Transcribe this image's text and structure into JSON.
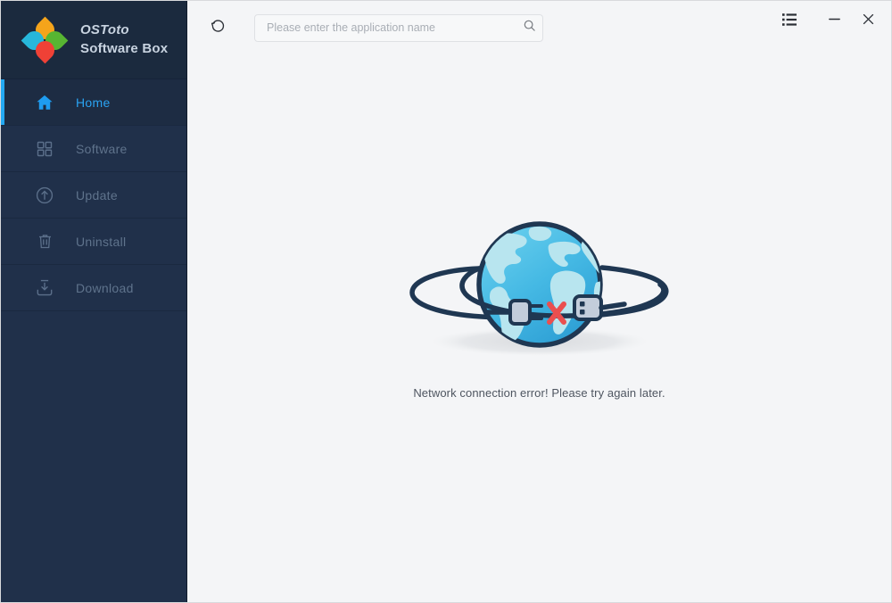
{
  "window": {
    "title": "OSToto Software Box"
  },
  "brand": {
    "logo_icon": "clover-logo-icon",
    "line1": "OSToto",
    "line2": "Software Box",
    "colors": {
      "petal_top": "#f5a41b",
      "petal_left": "#27b7db",
      "petal_right": "#57b532",
      "petal_bottom": "#ef4136"
    }
  },
  "sidebar": {
    "background": "#20304a",
    "accent": "#24a9f2",
    "items": [
      {
        "id": "home",
        "label": "Home",
        "icon": "home-icon",
        "active": true
      },
      {
        "id": "software",
        "label": "Software",
        "icon": "grid-squares-icon",
        "active": false
      },
      {
        "id": "update",
        "label": "Update",
        "icon": "arrow-up-circle-icon",
        "active": false
      },
      {
        "id": "uninstall",
        "label": "Uninstall",
        "icon": "trash-icon",
        "active": false
      },
      {
        "id": "download",
        "label": "Download",
        "icon": "download-tray-icon",
        "active": false
      }
    ]
  },
  "toolbar": {
    "refresh_icon": "refresh-icon",
    "search": {
      "placeholder": "Please enter the application name",
      "value": "",
      "icon": "search-icon"
    }
  },
  "window_controls": {
    "menu_icon": "list-menu-icon",
    "minimize_icon": "minimize-icon",
    "close_icon": "close-icon"
  },
  "main": {
    "empty_state": {
      "illustration": "globe-disconnected-plug-icon",
      "message": "Network connection error! Please try again later.",
      "colors": {
        "globe_light": "#5bc6e8",
        "globe_dark": "#2e9fd4",
        "continents": "#b8e5ef",
        "ring": "#1f3752",
        "error_x": "#ea4f4f",
        "shadow": "#e4e6e8"
      }
    }
  }
}
